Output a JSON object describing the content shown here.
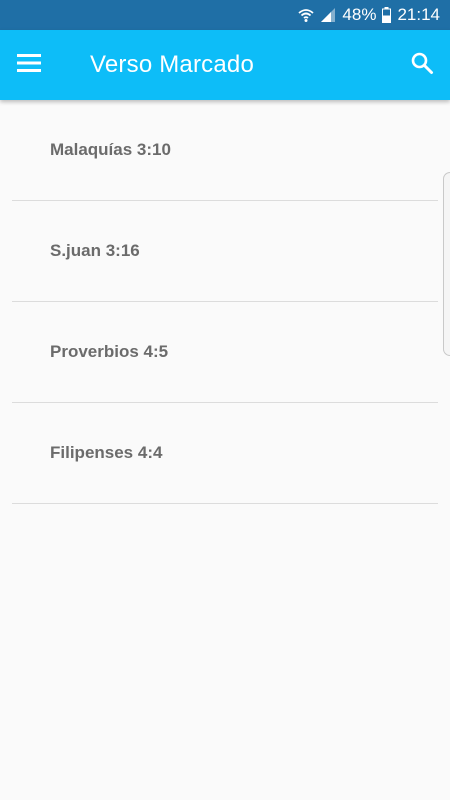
{
  "status_bar": {
    "battery": "48%",
    "time": "21:14",
    "icons": [
      "wifi-icon",
      "signal-icon",
      "battery-icon"
    ]
  },
  "app_bar": {
    "title": "Verso Marcado",
    "menu_icon": "menu-icon",
    "search_icon": "search-icon",
    "color": "#0dbdf8"
  },
  "colors": {
    "status_bar": "#1f6fa6",
    "background": "#fafafa",
    "item_text": "#6b6b6b",
    "divider": "#dcdcdc"
  },
  "list": {
    "items": [
      {
        "label": "Malaquías 3:10"
      },
      {
        "label": "S.juan 3:16"
      },
      {
        "label": "Proverbios 4:5"
      },
      {
        "label": "Filipenses 4:4"
      }
    ]
  }
}
